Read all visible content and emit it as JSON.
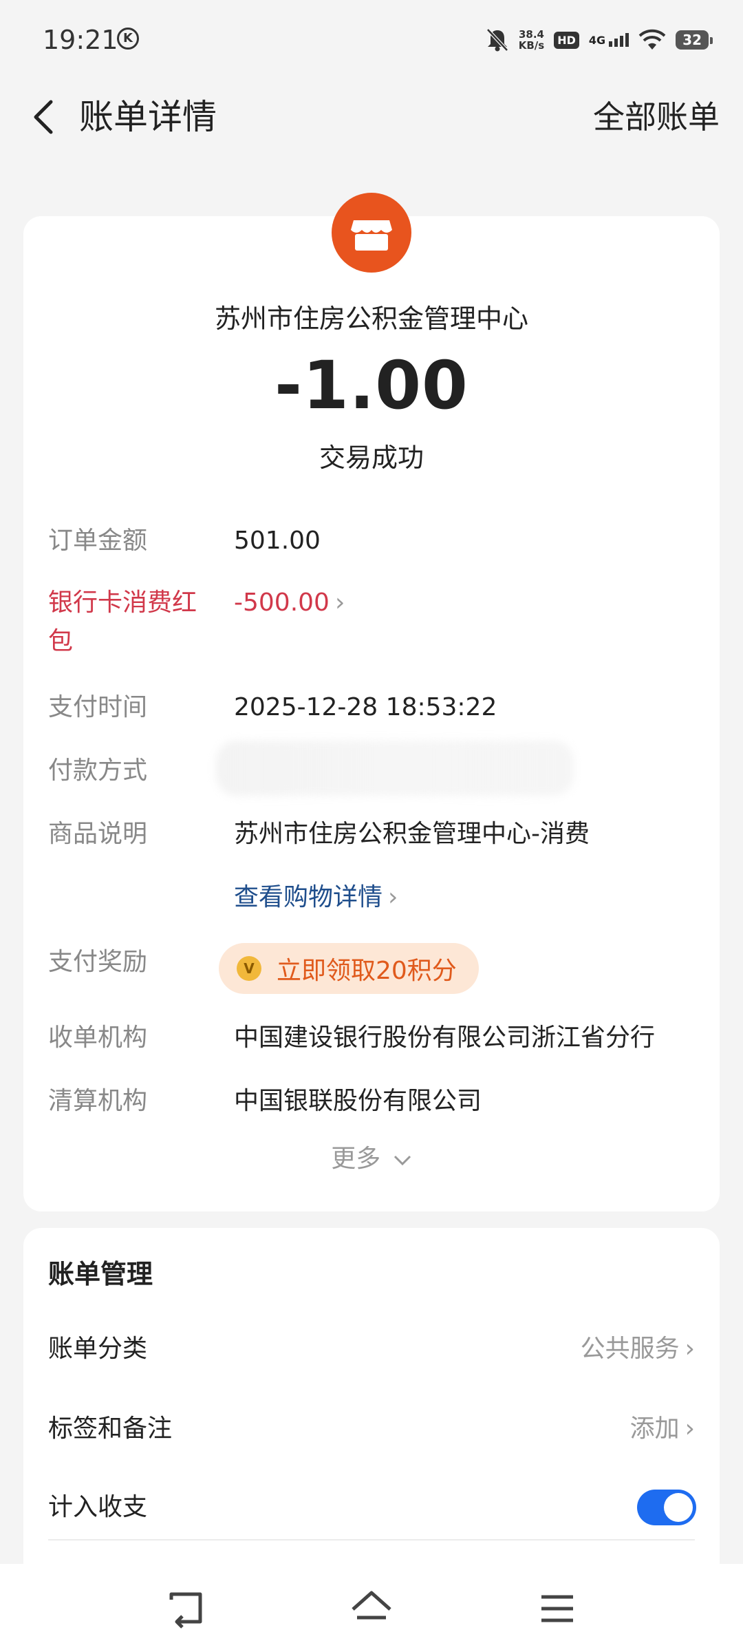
{
  "status_bar": {
    "time": "19:21",
    "k_badge": "K",
    "net_speed_value": "38.4",
    "net_speed_unit": "KB/s",
    "hd": "HD",
    "network": "4G",
    "battery": "32"
  },
  "header": {
    "title": "账单详情",
    "right_action": "全部账单"
  },
  "detail": {
    "merchant_icon": "store-icon",
    "merchant_color": "#e8541e",
    "merchant_name": "苏州市住房公积金管理中心",
    "amount": "-1.00",
    "status": "交易成功",
    "rows": {
      "order_amount": {
        "label": "订单金额",
        "value": "501.00"
      },
      "red_packet": {
        "label_line1": "银行卡消费红",
        "label_line2": "包",
        "value": "-500.00"
      },
      "pay_time": {
        "label": "支付时间",
        "value": "2025-12-28 18:53:22"
      },
      "pay_method": {
        "label": "付款方式",
        "value": ""
      },
      "goods_desc": {
        "label": "商品说明",
        "value": "苏州市住房公积金管理中心-消费",
        "link": "查看购物详情"
      },
      "reward": {
        "label": "支付奖励",
        "coin": "V",
        "value": "立即领取20积分"
      },
      "acquirer": {
        "label": "收单机构",
        "value": "中国建设银行股份有限公司浙江省分行"
      },
      "clearing": {
        "label": "清算机构",
        "value": "中国银联股份有限公司"
      }
    },
    "more": "更多"
  },
  "manage": {
    "title": "账单管理",
    "category": {
      "label": "账单分类",
      "value": "公共服务"
    },
    "tags": {
      "label": "标签和备注",
      "value": "添加"
    },
    "count_in": {
      "label": "计入收支",
      "enabled": true
    }
  },
  "colors": {
    "accent_blue": "#1e6cf0",
    "red": "#d1384a",
    "orange": "#e05a1c"
  }
}
